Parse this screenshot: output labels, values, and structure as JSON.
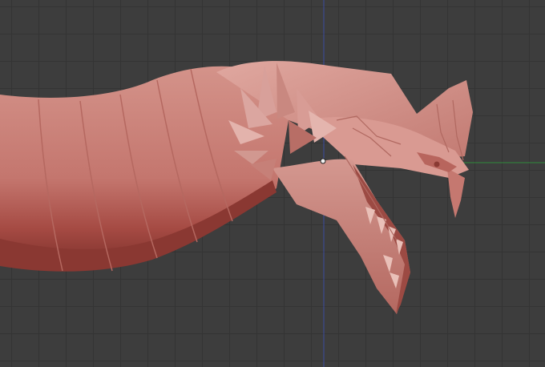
{
  "viewport": {
    "kind": "3d-viewport",
    "model": "dragon-head-mesh",
    "shading": "solid",
    "colors": {
      "background": "#3d3d3d",
      "grid": "#343434",
      "axis_y": "#3b4aa0",
      "axis_x": "#2f8a3a",
      "mesh_base": "#c87a72",
      "mesh_shadow": "#8c3a34",
      "mesh_highlight": "#e8b3ab"
    }
  },
  "icons": {
    "cursor": "3d-cursor-icon"
  }
}
